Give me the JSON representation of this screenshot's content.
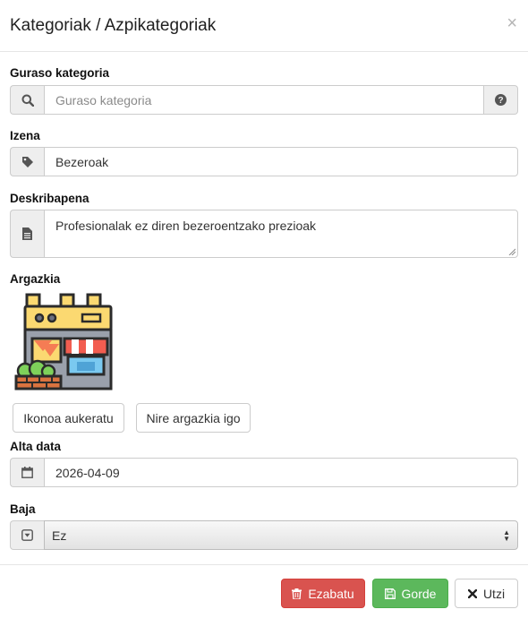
{
  "modal": {
    "title": "Kategoriak / Azpikategoriak",
    "close": "×"
  },
  "form": {
    "parent": {
      "label": "Guraso kategoria",
      "placeholder": "Guraso kategoria",
      "icon": "search-icon",
      "help_icon": "question-circle-icon"
    },
    "name": {
      "label": "Izena",
      "value": "Bezeroak",
      "icon": "tag-icon"
    },
    "description": {
      "label": "Deskribapena",
      "value": "Profesionalak ez diren bezeroentzako prezioak",
      "icon": "file-text-icon"
    },
    "image": {
      "label": "Argazkia",
      "icon": "store-icon"
    },
    "image_buttons": {
      "choose_icon": "Ikonoa aukeratu",
      "upload": "Nire argazkia igo"
    },
    "start_date": {
      "label": "Alta data",
      "value": "2026-04-09",
      "icon": "calendar-icon"
    },
    "removed": {
      "label": "Baja",
      "value": "Ez",
      "icon": "caret-square-down-icon"
    }
  },
  "footer": {
    "delete": "Ezabatu",
    "save": "Gorde",
    "cancel": "Utzi"
  },
  "colors": {
    "danger": "#d9534f",
    "success": "#5cb85c"
  }
}
